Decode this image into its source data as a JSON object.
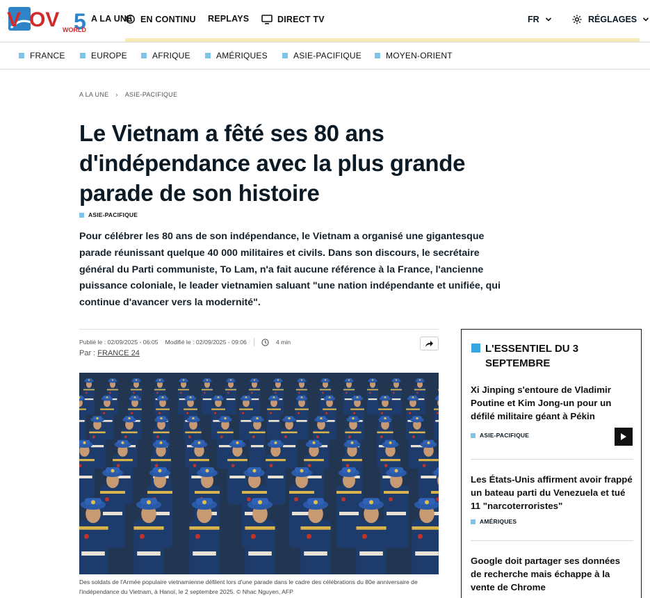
{
  "header": {
    "logo_text": "VOV5",
    "logo_sub": "WORLD",
    "nav": [
      {
        "label": "A LA UNE",
        "icon": "play-icon"
      },
      {
        "label": "EN CONTINU",
        "icon": "history-icon"
      },
      {
        "label": "REPLAYS",
        "icon": ""
      },
      {
        "label": "DIRECT TV",
        "icon": "tv-icon"
      }
    ],
    "language": "FR",
    "settings_label": "RÉGLAGES"
  },
  "sections": [
    "FRANCE",
    "EUROPE",
    "AFRIQUE",
    "AMÉRIQUES",
    "ASIE-PACIFIQUE",
    "MOYEN-ORIENT"
  ],
  "breadcrumb": [
    "A LA UNE",
    "ASIE-PACIFIQUE"
  ],
  "article": {
    "title": "Le Vietnam a fêté ses 80 ans d'indépendance avec la plus grande parade de son histoire",
    "tag": "ASIE-PACIFIQUE",
    "lede": "Pour célébrer les 80 ans de son indépendance, le Vietnam a organisé une gigantesque parade réunissant quelque 40 000 militaires et civils. Dans son discours, le secrétaire général du Parti communiste, To Lam, n'a fait aucune référence à la France, l'ancienne puissance coloniale, le leader vietnamien saluant \"une nation indépendante et unifiée, qui continue d'avancer vers la modernité\".",
    "published": "Publié le : 02/09/2025 - 06:05",
    "modified": "Modifié le : 02/09/2025 - 09:06",
    "read_time": "4 min",
    "by_label": "Par :",
    "author": "FRANCE 24",
    "caption": "Des soldats de l'Armée populaire vietnamienne défilent lors d'une parade dans le cadre des célébrations du 80e anniversaire de l'indépendance du Vietnam, à Hanoï, le 2 septembre 2025. © Nhac Nguyen, AFP"
  },
  "sidebar": {
    "heading": "L'ESSENTIEL DU 3 SEPTEMBRE",
    "items": [
      {
        "title": "Xi Jinping s'entoure de Vladimir Poutine et Kim Jong-un pour un défilé militaire géant à Pékin",
        "tag": "ASIE-PACIFIQUE"
      },
      {
        "title": "Les États-Unis affirment avoir frappé un bateau parti du Venezuela et tué 11 \"narcoterroristes\"",
        "tag": "AMÉRIQUES"
      },
      {
        "title": "Google doit partager ses données de recherche mais échappe à la vente de Chrome",
        "tag": ""
      }
    ]
  },
  "colors": {
    "accent": "#7cc4e8",
    "sidebar_accent": "#35a6df",
    "text": "#0b1a25"
  }
}
